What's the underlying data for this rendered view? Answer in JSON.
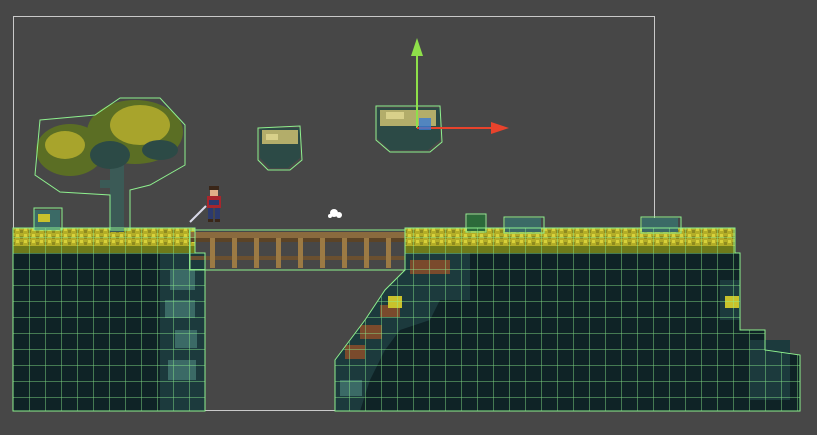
{
  "editor": {
    "background_color": "#474747",
    "frame_color": "#c9c9c9"
  },
  "tilemap": {
    "grid_color": "#8ef08e",
    "rock_dark": "#0f2326",
    "rock_mid": "#1c3a3d",
    "rock_light": "#3b6a66",
    "grass": "#c9c22c",
    "grass_dark": "#6e7a1a",
    "dirt": "#7a4a2c"
  },
  "gizmo": {
    "x_axis_color": "#e8432c",
    "y_axis_color": "#8ee04a",
    "center_color": "#3a7bd5",
    "y_arrow_icon": "up-arrow-icon",
    "x_arrow_icon": "right-arrow-icon"
  },
  "sprites": {
    "player": "swordsman-player-icon",
    "tree": "leafy-tree-icon",
    "platform": "floating-rock-platform-icon",
    "pickup": "white-sparkle-icon"
  }
}
